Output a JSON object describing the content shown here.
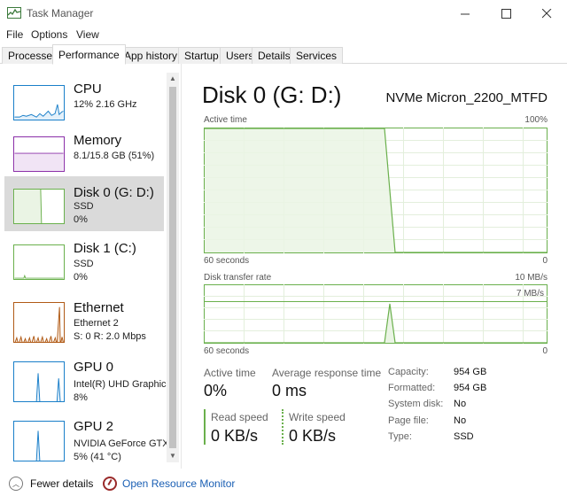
{
  "window": {
    "title": "Task Manager",
    "controls": [
      "minimize-icon",
      "maximize-icon",
      "close-icon"
    ]
  },
  "menu": [
    "File",
    "Options",
    "View"
  ],
  "tabs": [
    "Processes",
    "Performance",
    "App history",
    "Startup",
    "Users",
    "Details",
    "Services"
  ],
  "active_tab": "Performance",
  "sidebar": [
    {
      "title": "CPU",
      "line1": "12%  2.16 GHz",
      "line2": ""
    },
    {
      "title": "Memory",
      "line1": "8.1/15.8 GB (51%)",
      "line2": ""
    },
    {
      "title": "Disk 0 (G: D:)",
      "line1": "SSD",
      "line2": "0%"
    },
    {
      "title": "Disk 1 (C:)",
      "line1": "SSD",
      "line2": "0%"
    },
    {
      "title": "Ethernet",
      "line1": "Ethernet 2",
      "line2": "S: 0  R: 2.0 Mbps"
    },
    {
      "title": "GPU 0",
      "line1": "Intel(R) UHD Graphics",
      "line2": "8%"
    },
    {
      "title": "GPU 2",
      "line1": "NVIDIA GeForce GTX",
      "line2": "5%  (41 °C)"
    }
  ],
  "selected_item": "Disk 0 (G: D:)",
  "detail": {
    "title": "Disk 0 (G: D:)",
    "model": "NVMe Micron_2200_MTFD",
    "active_time_chart": {
      "label": "Active time",
      "max_label": "100%",
      "x_left": "60 seconds",
      "x_right": "0"
    },
    "transfer_chart": {
      "label": "Disk transfer rate",
      "max_label": "10 MB/s",
      "inner_label": "7 MB/s",
      "x_left": "60 seconds",
      "x_right": "0"
    },
    "stats": {
      "active_time_label": "Active time",
      "active_time_value": "0%",
      "avg_response_label": "Average response time",
      "avg_response_value": "0 ms",
      "read_speed_label": "Read speed",
      "read_speed_value": "0 KB/s",
      "write_speed_label": "Write speed",
      "write_speed_value": "0 KB/s"
    },
    "properties": [
      {
        "label": "Capacity:",
        "value": "954 GB"
      },
      {
        "label": "Formatted:",
        "value": "954 GB"
      },
      {
        "label": "System disk:",
        "value": "No"
      },
      {
        "label": "Page file:",
        "value": "No"
      },
      {
        "label": "Type:",
        "value": "SSD"
      }
    ]
  },
  "footer": {
    "fewer_details": "Fewer details",
    "open_resource_monitor": "Open Resource Monitor"
  },
  "colors": {
    "disk_green": "#6ab04c",
    "disk_fill": "#eaf4e4",
    "cpu_blue": "#1a7fc9",
    "memory_purple": "#8b2fa8",
    "ethernet_orange": "#b05a16",
    "link_blue": "#1a5fb4"
  }
}
